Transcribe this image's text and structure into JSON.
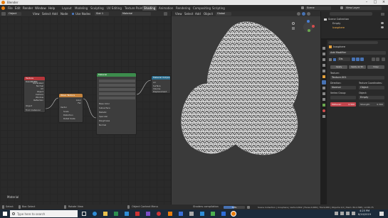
{
  "window": {
    "title": "Blender"
  },
  "menu": {
    "file": "File",
    "edit": "Edit",
    "render": "Render",
    "window": "Window",
    "help": "Help"
  },
  "workspaces": [
    "Layout",
    "Modeling",
    "Sculpting",
    "UV Editing",
    "Texture Paint",
    "Shading",
    "Animation",
    "Rendering",
    "Compositing",
    "Scripting"
  ],
  "active_workspace": "Shading",
  "scene": {
    "scene_label": "Scene",
    "view_layer": "View Layer"
  },
  "node_header": {
    "object_mode": "Object",
    "view": "View",
    "select": "Select",
    "add": "Add",
    "node": "Node",
    "use_nodes": "Use Nodes",
    "slot": "Slot 1",
    "material": "Material"
  },
  "viewport_header": {
    "view": "View",
    "select": "Select",
    "add": "Add",
    "object": "Object",
    "orientation": "Global"
  },
  "nodes": {
    "tex_coord": {
      "title": "Texture Coordinate",
      "rows": [
        "Generated",
        "Normal",
        "UV",
        "Object",
        "Camera",
        "Window",
        "Reflection",
        "Object",
        "From Instancer"
      ]
    },
    "wave": {
      "title": "Wave Texture",
      "rows": [
        "Color",
        "Fac",
        "Vector",
        "Scale",
        "Distortion",
        "Detail Scale"
      ]
    },
    "principled": {
      "title": "Material",
      "rows": [
        "Base Color",
        "Subsurface",
        "Metallic",
        "Specular",
        "Roughness",
        "Normal"
      ]
    },
    "output": {
      "title": "Material Output",
      "rows": [
        "All",
        "Surface",
        "Volume",
        "Displacement"
      ]
    }
  },
  "outliner": {
    "header": "Scene Collection",
    "items": [
      "Empty",
      "Icosphere"
    ]
  },
  "properties": {
    "object_name": "Icosphere",
    "add_modifier": "Add Modifier",
    "modifier_name": "Dis",
    "buttons": {
      "apply": "Apply",
      "apply_as_shape": "Apply as Sh.",
      "copy": "Copy"
    },
    "texture_label": "Texture:",
    "texture_value": "Texture.001",
    "direction_label": "Direction:",
    "texture_coords_label": "Texture Coordinates:",
    "direction_value": "Normal",
    "coords_value": "Object",
    "vertex_group_label": "Vertex Group:",
    "object_label": "Object:",
    "object_value": "Empty",
    "midlevel_label": "Midlevel:",
    "midlevel_value": "0.500",
    "strength_label": "Strength:",
    "strength_value": "0.300"
  },
  "node_footer": {
    "label": "Material"
  },
  "status": {
    "select": "Select",
    "box_select": "Box Select",
    "rotate_view": "Rotate View",
    "context_menu": "Object Context Menu",
    "shaders": "Shaders compilation",
    "progress_text": "50%",
    "progress_fraction": 0.5,
    "stats": "Scene Collection | Icosphere | Verts:4,842 | Faces:9,680 | Tris:9,680 | Objects:1/2 | Mem: 84.4 MiB | v2.80.75"
  },
  "taskbar": {
    "search_placeholder": "Type here to search",
    "time": "4:25 PM",
    "date": "8/10/2019"
  },
  "colors": {
    "accent_red": "#d24d4d",
    "node_blue": "#2c6e8f",
    "node_green": "#3c8c4c",
    "node_orange": "#c4833d",
    "taskbar": "#1b2a3a"
  }
}
